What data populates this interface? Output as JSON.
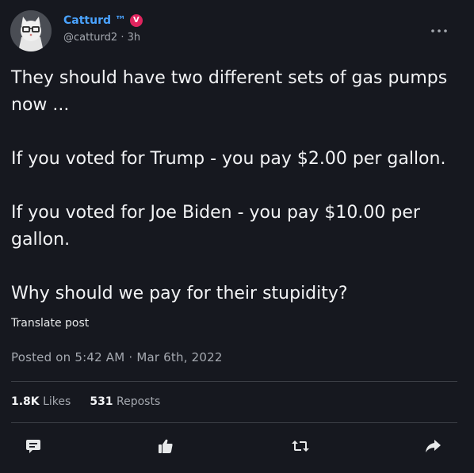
{
  "author": {
    "name": "Catturd ™",
    "handle": "@catturd2",
    "time": "3h",
    "badge_text": "V",
    "name_color": "#4aa3ff",
    "badge_color": "#e0245e"
  },
  "post": {
    "paragraphs": [
      "They should have two different sets of gas pumps now ...",
      "If you voted for Trump - you pay $2.00 per gallon.",
      "If you voted for Joe Biden - you pay $10.00 per gallon.",
      "Why should we pay for their stupidity?"
    ],
    "translate_label": "Translate post",
    "posted_on": "Posted on 5:42 AM · Mar 6th, 2022"
  },
  "stats": {
    "likes_count": "1.8K",
    "likes_label": "Likes",
    "reposts_count": "531",
    "reposts_label": "Reposts"
  },
  "actions": [
    {
      "name": "reply",
      "icon": "comment-icon"
    },
    {
      "name": "like",
      "icon": "thumbs-up-icon"
    },
    {
      "name": "repost",
      "icon": "repost-icon"
    },
    {
      "name": "share",
      "icon": "share-arrow-icon"
    }
  ],
  "more_menu_icon": "ellipsis-icon",
  "colors": {
    "background": "#16181f",
    "text": "#e7e9ea",
    "muted": "#a5a9b0",
    "divider": "#3b3e45"
  }
}
